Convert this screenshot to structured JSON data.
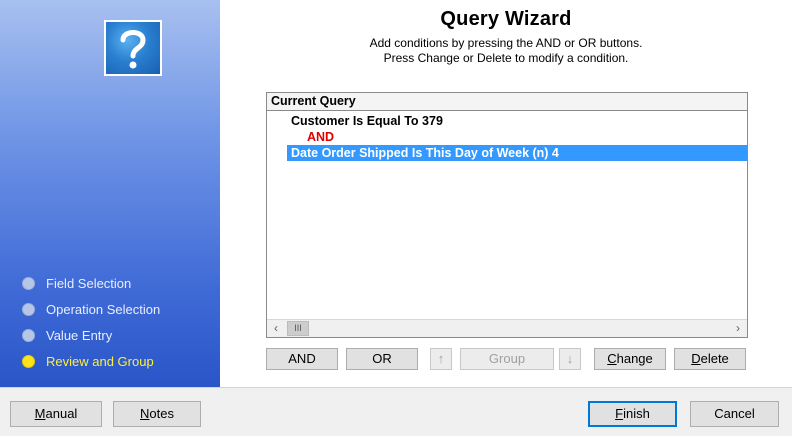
{
  "wizard": {
    "title": "Query Wizard",
    "subtitle_line1": "Add conditions by pressing the AND or OR buttons.",
    "subtitle_line2": "Press Change or Delete to modify a condition."
  },
  "steps": [
    {
      "label": "Field Selection",
      "active": false
    },
    {
      "label": "Operation Selection",
      "active": false
    },
    {
      "label": "Value Entry",
      "active": false
    },
    {
      "label": "Review and Group",
      "active": true
    }
  ],
  "query": {
    "header": "Current Query",
    "lines": [
      "Customer Is Equal To 379",
      "AND",
      "Date Order Shipped Is This Day of Week (n) 4"
    ],
    "selected_index": 2
  },
  "buttons": {
    "and": "AND",
    "or": "OR",
    "group": "Group",
    "change_prefix": "C",
    "change_rest": "hange",
    "delete_prefix": "D",
    "delete_rest": "elete"
  },
  "footer": {
    "manual_prefix": "M",
    "manual_rest": "anual",
    "notes_prefix": "N",
    "notes_rest": "otes",
    "finish_prefix": "F",
    "finish_rest": "inish",
    "cancel": "Cancel"
  },
  "icons": {
    "logo": "question-mark-icon",
    "move_up": "arrow-up-icon",
    "move_down": "arrow-down-icon",
    "scroll_left": "chevron-left-icon",
    "scroll_right": "chevron-right-icon"
  },
  "colors": {
    "selection": "#3399ff",
    "operator_red": "#e00000",
    "active_step": "#ffef3a"
  }
}
